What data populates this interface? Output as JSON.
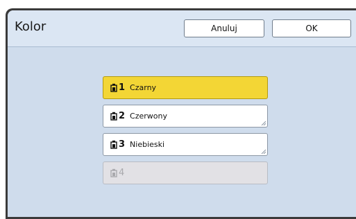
{
  "dialog": {
    "title": "Kolor",
    "cancel_label": "Anuluj",
    "ok_label": "OK"
  },
  "colors": [
    {
      "number": "1",
      "name": "Czarny",
      "state": "selected"
    },
    {
      "number": "2",
      "name": "Czerwony",
      "state": "normal"
    },
    {
      "number": "3",
      "name": "Niebieski",
      "state": "normal"
    },
    {
      "number": "4",
      "name": "",
      "state": "disabled"
    }
  ],
  "theme": {
    "background": "#cfdcec",
    "header": "#dbe6f3",
    "selected": "#f3d635",
    "disabled": "#e2e1e5"
  }
}
